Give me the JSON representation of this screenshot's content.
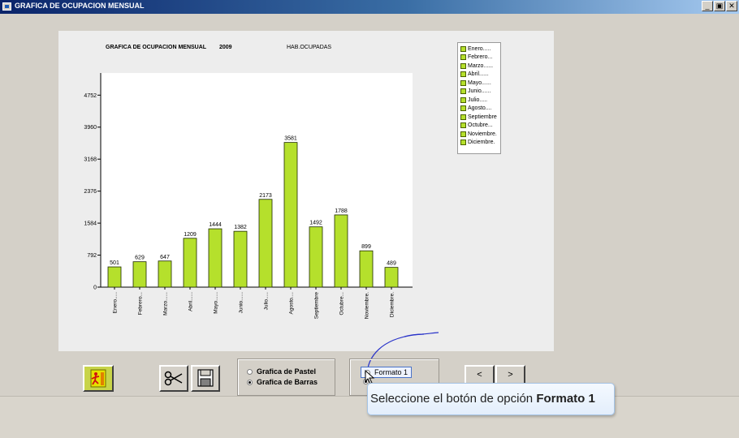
{
  "window": {
    "title": "GRAFICA DE OCUPACION MENSUAL",
    "buttons": [
      "_",
      " 7",
      "×"
    ]
  },
  "chart_header": {
    "title": "GRAFICA DE OCUPACION MENSUAL",
    "year": "2009",
    "series_label": "HAB.OCUPADAS"
  },
  "chart_data": {
    "type": "bar",
    "title": "GRAFICA DE OCUPACION MENSUAL 2009",
    "series_name": "HAB.OCUPADAS",
    "categories": [
      "Enero.....",
      "Febrero...",
      "Marzo......",
      "Abril......",
      "Mayo......",
      "Junio......",
      "Julio.....",
      "Agosto....",
      "Septiembre",
      "Octubre...",
      "Noviembre.",
      "Diciembre."
    ],
    "values": [
      501,
      629,
      647,
      1209,
      1444,
      1382,
      2173,
      3581,
      1492,
      1788,
      899,
      489
    ],
    "y_ticks": [
      0,
      792,
      1584,
      2376,
      3168,
      3960,
      4752
    ],
    "ylim": [
      0,
      5300
    ],
    "bar_color": "#b5e02c",
    "legend_placement": "right"
  },
  "legend": [
    "Enero.....",
    "Febrero...",
    "Marzo......",
    "Abril......",
    "Mayo......",
    "Junio......",
    "Julio.....",
    "Agosto....",
    "Septiembre",
    "Octubre...",
    "Noviembre.",
    "Diciembre."
  ],
  "controls": {
    "exit_icon": "exit-door-icon",
    "cut_icon": "scissors-icon",
    "save_icon": "floppy-disk-icon",
    "chart_type_options": [
      {
        "label": "Grafica de Pastel",
        "checked": false
      },
      {
        "label": "Grafica de Barras",
        "checked": true
      }
    ],
    "format_options": [
      {
        "label": "Formato 1",
        "checked": false
      }
    ],
    "prev_label": "<",
    "next_label": ">"
  },
  "tooltip": {
    "text": "Seleccione el botón de opción",
    "bold": "Formato 1"
  }
}
